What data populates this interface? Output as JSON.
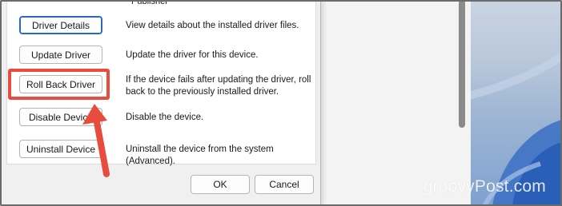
{
  "dialog": {
    "publisher_label": "Publisher",
    "actions": [
      {
        "label": "Driver Details",
        "description": "View details about the installed driver files."
      },
      {
        "label": "Update Driver",
        "description": "Update the driver for this device."
      },
      {
        "label": "Roll Back Driver",
        "description": "If the device fails after updating the driver, roll back to the previously installed driver."
      },
      {
        "label": "Disable Device",
        "description": "Disable the device."
      },
      {
        "label": "Uninstall Device",
        "description": "Uninstall the device from the system (Advanced)."
      }
    ],
    "ok_label": "OK",
    "cancel_label": "Cancel"
  },
  "annotation": {
    "highlight_color": "#e74c3c",
    "arrow_color": "#e74c3c"
  },
  "watermark": "groovyPost.com"
}
